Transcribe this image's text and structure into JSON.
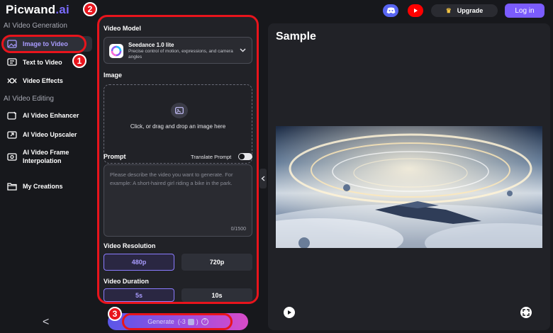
{
  "brand": {
    "name": "Picwand",
    "suffix": ".ai"
  },
  "sidebar": {
    "section_generation": "AI Video Generation",
    "section_editing": "AI Video Editing",
    "items": [
      {
        "label": "Image to Video",
        "icon": "image-icon"
      },
      {
        "label": "Text to Video",
        "icon": "text-icon"
      },
      {
        "label": "Video Effects",
        "icon": "effects-icon"
      },
      {
        "label": "AI Video Enhancer",
        "icon": "enhancer-icon"
      },
      {
        "label": "AI Video Upscaler",
        "icon": "upscaler-icon"
      },
      {
        "label": "AI Video Frame",
        "label2": "Interpolation",
        "icon": "frame-icon"
      },
      {
        "label": "My Creations",
        "icon": "folder-icon"
      }
    ],
    "collapse": "<"
  },
  "panel": {
    "video_model_label": "Video Model",
    "model": {
      "name": "Seedance 1.0 lite",
      "description": "Precise control of motion, expressions, and camera angles"
    },
    "image_label": "Image",
    "dropzone_text": "Click, or drag and drop an image here",
    "prompt_label": "Prompt",
    "translate_label": "Translate Prompt",
    "prompt_placeholder": "Please describe the video you want to generate. For example: A short-haired girl riding a bike in the park.",
    "prompt_counter": "0/1500",
    "resolution_label": "Video Resolution",
    "resolutions": [
      "480p",
      "720p"
    ],
    "duration_label": "Video Duration",
    "durations": [
      "5s",
      "10s"
    ]
  },
  "generate": {
    "label": "Generate",
    "cost": "(-3",
    "cost_end": ")",
    "help": "?"
  },
  "header": {
    "upgrade": "Upgrade",
    "login": "Log in"
  },
  "sample": {
    "title": "Sample"
  },
  "annotations": [
    "1",
    "2",
    "3"
  ],
  "colors": {
    "accent": "#7b5cff",
    "highlight": "#e8141c",
    "background": "#17181c",
    "panel": "#212227"
  }
}
